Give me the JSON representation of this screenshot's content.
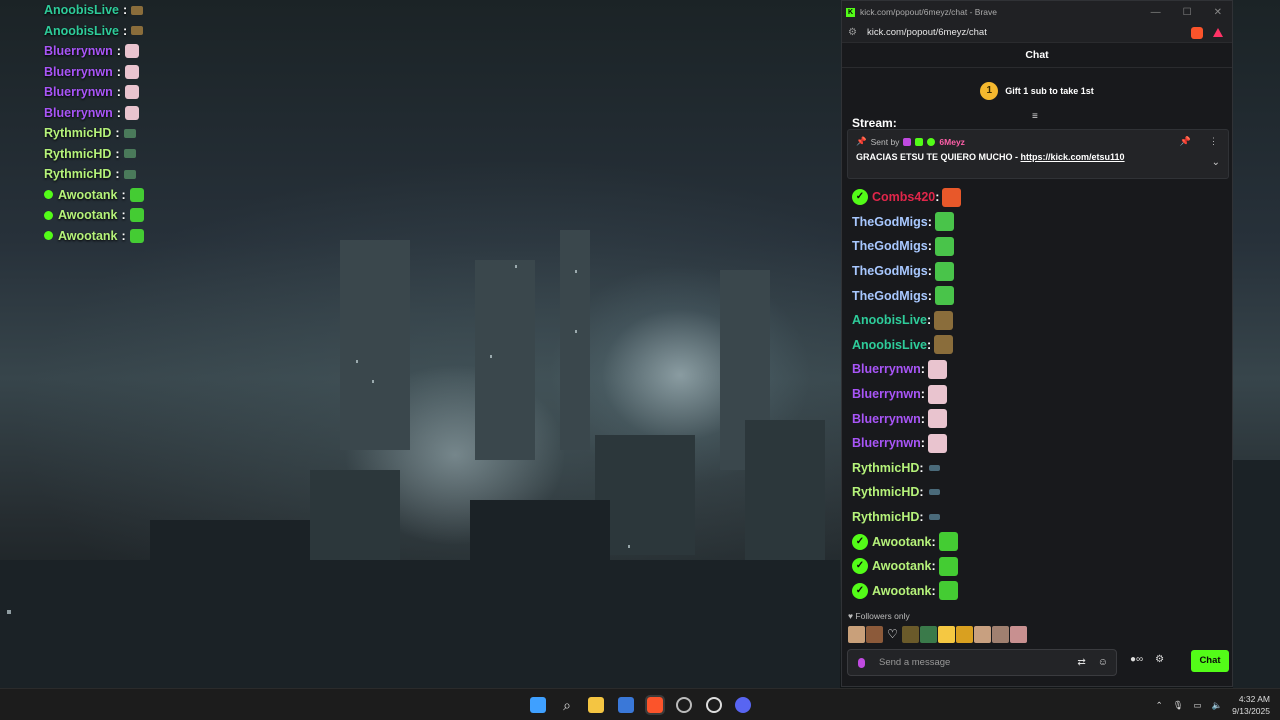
{
  "overlay_chat": [
    {
      "user": "AnoobisLive",
      "color": "#2ecc9a",
      "verified": false,
      "emote": "#8a6d3b",
      "emote_small": true
    },
    {
      "user": "AnoobisLive",
      "color": "#2ecc9a",
      "verified": false,
      "emote": "#8a6d3b",
      "emote_small": true
    },
    {
      "user": "Bluerrynwn",
      "color": "#a855f7",
      "verified": false,
      "emote": "#e9c4cf",
      "emote_small": false
    },
    {
      "user": "Bluerrynwn",
      "color": "#a855f7",
      "verified": false,
      "emote": "#e9c4cf",
      "emote_small": false
    },
    {
      "user": "Bluerrynwn",
      "color": "#a855f7",
      "verified": false,
      "emote": "#e9c4cf",
      "emote_small": false
    },
    {
      "user": "Bluerrynwn",
      "color": "#a855f7",
      "verified": false,
      "emote": "#e9c4cf",
      "emote_small": false
    },
    {
      "user": "RythmicHD",
      "color": "#b5f27a",
      "verified": false,
      "emote": "#4a7a5a",
      "emote_small": true
    },
    {
      "user": "RythmicHD",
      "color": "#b5f27a",
      "verified": false,
      "emote": "#4a7a5a",
      "emote_small": true
    },
    {
      "user": "RythmicHD",
      "color": "#b5f27a",
      "verified": false,
      "emote": "#4a7a5a",
      "emote_small": true
    },
    {
      "user": "Awootank",
      "color": "#b5f27a",
      "verified": true,
      "emote": "#44cc33",
      "emote_small": false
    },
    {
      "user": "Awootank",
      "color": "#b5f27a",
      "verified": true,
      "emote": "#44cc33",
      "emote_small": false
    },
    {
      "user": "Awootank",
      "color": "#b5f27a",
      "verified": true,
      "emote": "#44cc33",
      "emote_small": false
    }
  ],
  "browser": {
    "title": "kick.com/popout/6meyz/chat - Brave",
    "url": "kick.com/popout/6meyz/chat",
    "min_glyph": "—",
    "max_glyph": "☐",
    "close_glyph": "✕"
  },
  "chat": {
    "header": "Chat",
    "gift_rank": "1",
    "gift_text": "Gift 1 sub to take 1st",
    "stream_fragment": "Stream:",
    "pinned": {
      "sent_by": "Sent by",
      "sender": "6Meyz",
      "message": "GRACIAS ETSU TE QUIERO MUCHO - ",
      "link": "https://kick.com/etsu110"
    },
    "messages": [
      {
        "user": "Combs420",
        "color": "#e0264a",
        "verified": true,
        "emote": "#e8582a",
        "emote_small": false
      },
      {
        "user": "TheGodMigs",
        "color": "#a8c8ff",
        "verified": false,
        "emote": "#49c44a",
        "emote_small": false
      },
      {
        "user": "TheGodMigs",
        "color": "#a8c8ff",
        "verified": false,
        "emote": "#49c44a",
        "emote_small": false
      },
      {
        "user": "TheGodMigs",
        "color": "#a8c8ff",
        "verified": false,
        "emote": "#49c44a",
        "emote_small": false
      },
      {
        "user": "TheGodMigs",
        "color": "#a8c8ff",
        "verified": false,
        "emote": "#49c44a",
        "emote_small": false
      },
      {
        "user": "AnoobisLive",
        "color": "#2ecc9a",
        "verified": false,
        "emote": "#8a6d3b",
        "emote_small": false
      },
      {
        "user": "AnoobisLive",
        "color": "#2ecc9a",
        "verified": false,
        "emote": "#8a6d3b",
        "emote_small": false
      },
      {
        "user": "Bluerrynwn",
        "color": "#a855f7",
        "verified": false,
        "emote": "#e9c4cf",
        "emote_small": false
      },
      {
        "user": "Bluerrynwn",
        "color": "#a855f7",
        "verified": false,
        "emote": "#e9c4cf",
        "emote_small": false
      },
      {
        "user": "Bluerrynwn",
        "color": "#a855f7",
        "verified": false,
        "emote": "#e9c4cf",
        "emote_small": false
      },
      {
        "user": "Bluerrynwn",
        "color": "#a855f7",
        "verified": false,
        "emote": "#e9c4cf",
        "emote_small": false
      },
      {
        "user": "RythmicHD",
        "color": "#b5f27a",
        "verified": false,
        "emote": "#4a6a7a",
        "emote_small": true
      },
      {
        "user": "RythmicHD",
        "color": "#b5f27a",
        "verified": false,
        "emote": "#4a6a7a",
        "emote_small": true
      },
      {
        "user": "RythmicHD",
        "color": "#b5f27a",
        "verified": false,
        "emote": "#4a6a7a",
        "emote_small": true
      },
      {
        "user": "Awootank",
        "color": "#b5f27a",
        "verified": true,
        "emote": "#44cc33",
        "emote_small": false
      },
      {
        "user": "Awootank",
        "color": "#b5f27a",
        "verified": true,
        "emote": "#44cc33",
        "emote_small": false
      },
      {
        "user": "Awootank",
        "color": "#b5f27a",
        "verified": true,
        "emote": "#44cc33",
        "emote_small": false
      }
    ],
    "followers_only": "Followers only",
    "emote_bar": [
      "#c9a07a",
      "#8c5a3a",
      "#ffffff",
      "#6a5a2a",
      "#3a7a4a",
      "#f5c842",
      "#d9a020",
      "#c8a080",
      "#a08070",
      "#c89090"
    ],
    "input_placeholder": "Send a message",
    "send_label": "Chat"
  },
  "taskbar": {
    "time": "4:32 AM",
    "date": "9/13/2025"
  },
  "colors": {
    "kick_green": "#53fc18",
    "chat_bg": "#18191c"
  }
}
